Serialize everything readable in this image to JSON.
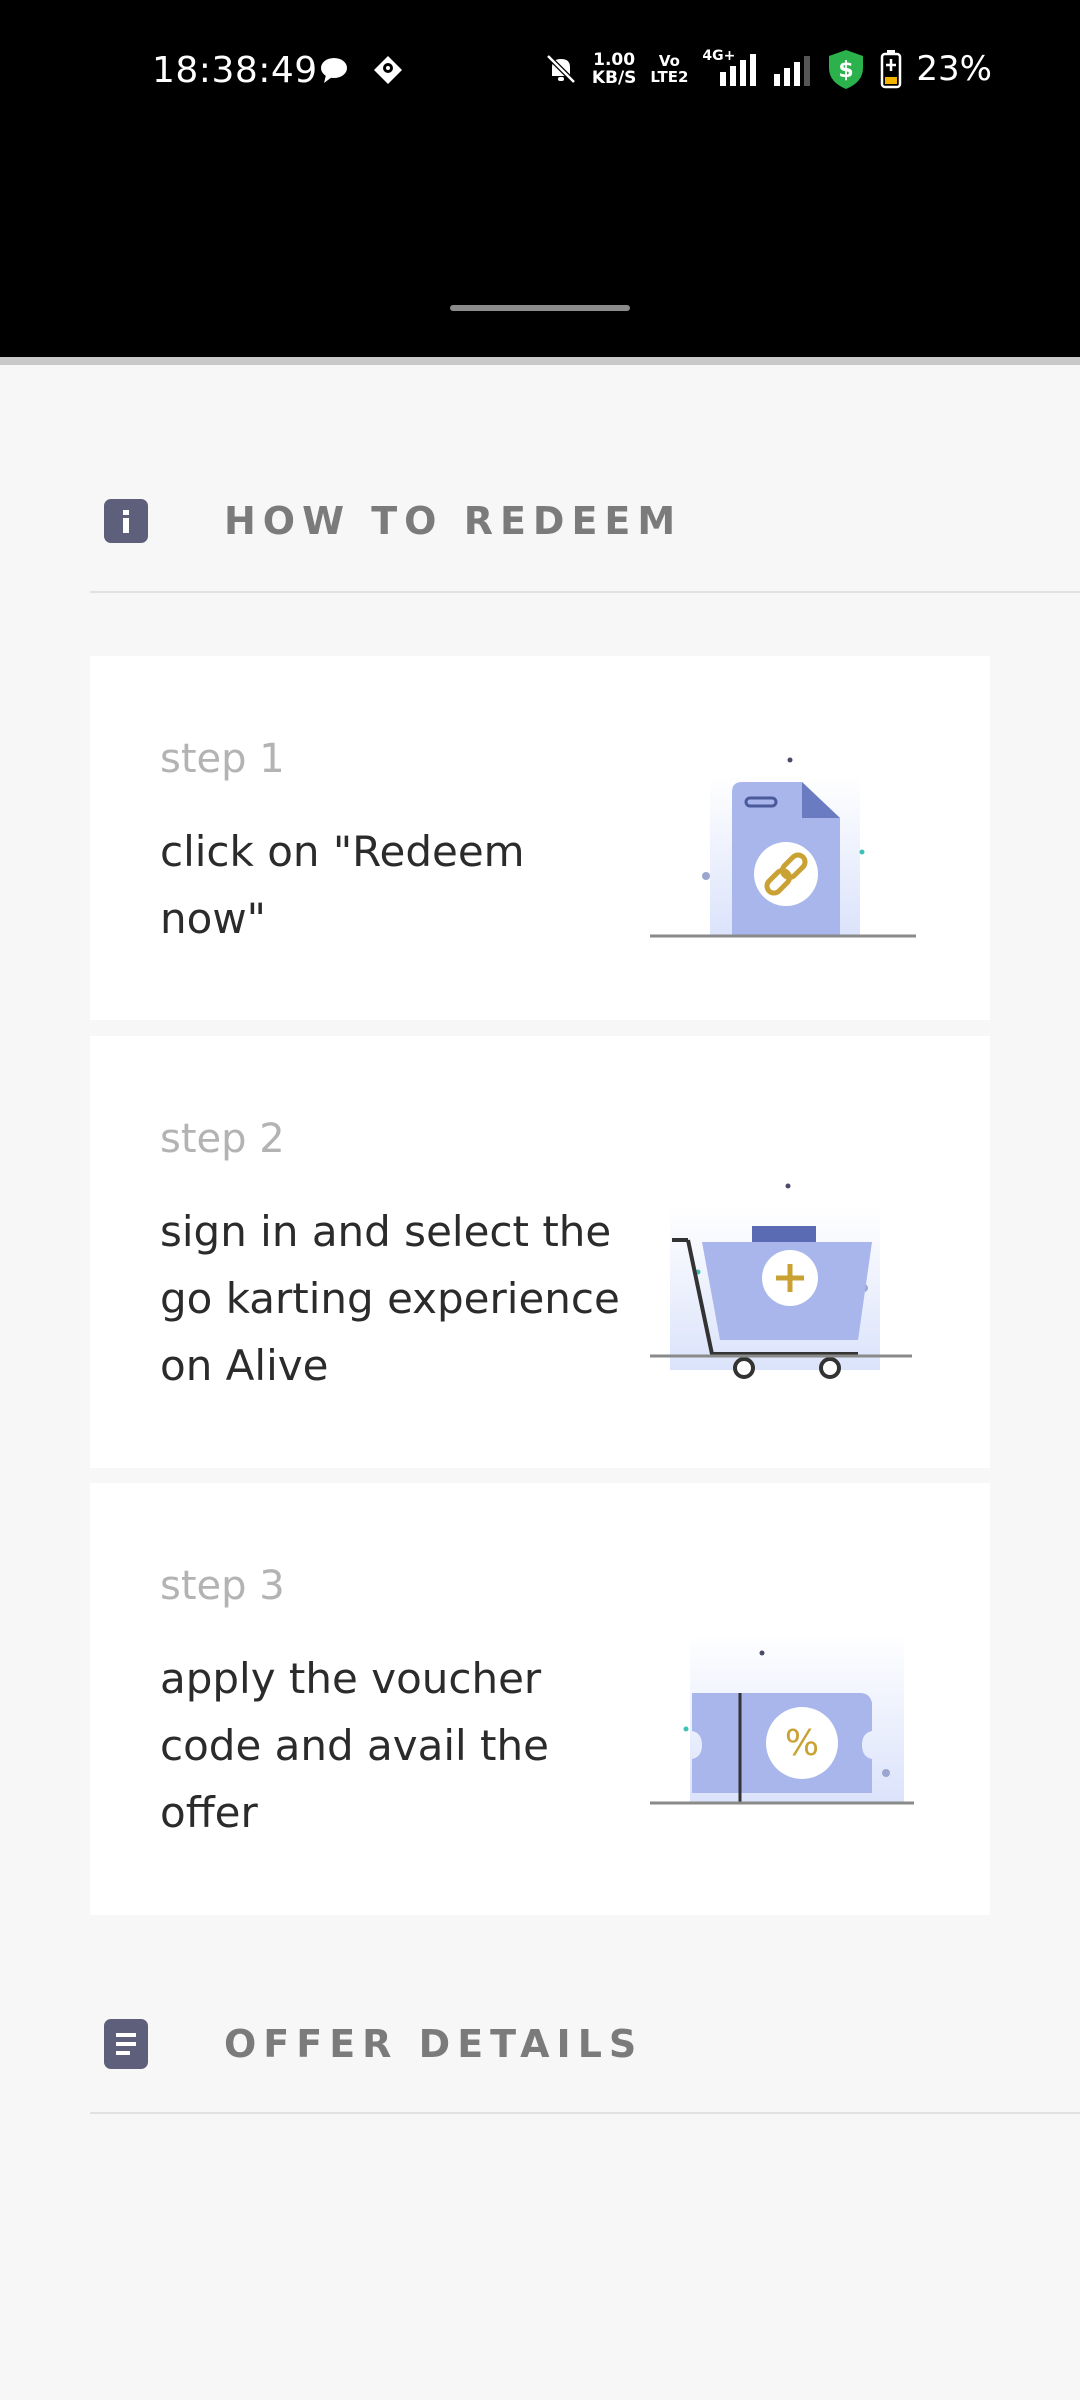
{
  "status_bar": {
    "time": "18:38:49",
    "net_speed_value": "1.00",
    "net_speed_unit": "KB/S",
    "volte_top": "Vo",
    "volte_bottom": "LTE2",
    "network": "4G+",
    "battery": "23%",
    "icons": [
      "chat-bubble-icon",
      "location-pin-icon",
      "mute-bell-icon",
      "signal-icon",
      "shield-dollar-icon",
      "battery-icon"
    ]
  },
  "how_to_redeem": {
    "title": "HOW TO REDEEM",
    "icon": "info-icon",
    "steps": [
      {
        "label": "step 1",
        "text": "click on \"Redeem now\"",
        "illustration": "document-link-icon"
      },
      {
        "label": "step 2",
        "text": "sign in and select the go karting experience on Alive",
        "illustration": "shopping-cart-add-icon"
      },
      {
        "label": "step 3",
        "text": "apply the voucher code and avail the offer",
        "illustration": "voucher-percent-icon"
      }
    ]
  },
  "offer_details": {
    "title": "OFFER DETAILS",
    "icon": "list-icon"
  },
  "colors": {
    "accent_illustration": "#a8b6ec",
    "accent_dark": "#6a7bc2",
    "gold": "#c9a233",
    "section_icon": "#5e5f7a",
    "shield_green": "#2bb24c"
  }
}
